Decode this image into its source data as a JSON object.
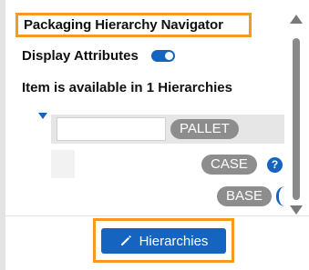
{
  "panel": {
    "title": "Packaging Hierarchy Navigator",
    "display_attributes_label": "Display Attributes",
    "display_attributes_on": true,
    "availability_text": "Item is available in 1 Hierarchies"
  },
  "tree": {
    "pallet": {
      "value": "",
      "badge": "PALLET"
    },
    "case": {
      "badge": "CASE",
      "help": "?"
    },
    "base": {
      "badge": "BASE"
    }
  },
  "footer": {
    "hierarchies_button": "Hierarchies",
    "hierarchies_icon": "pencil-icon"
  },
  "colors": {
    "accent": "#1565c0",
    "highlight": "#f39a1f",
    "badge": "#8d8d8d"
  }
}
